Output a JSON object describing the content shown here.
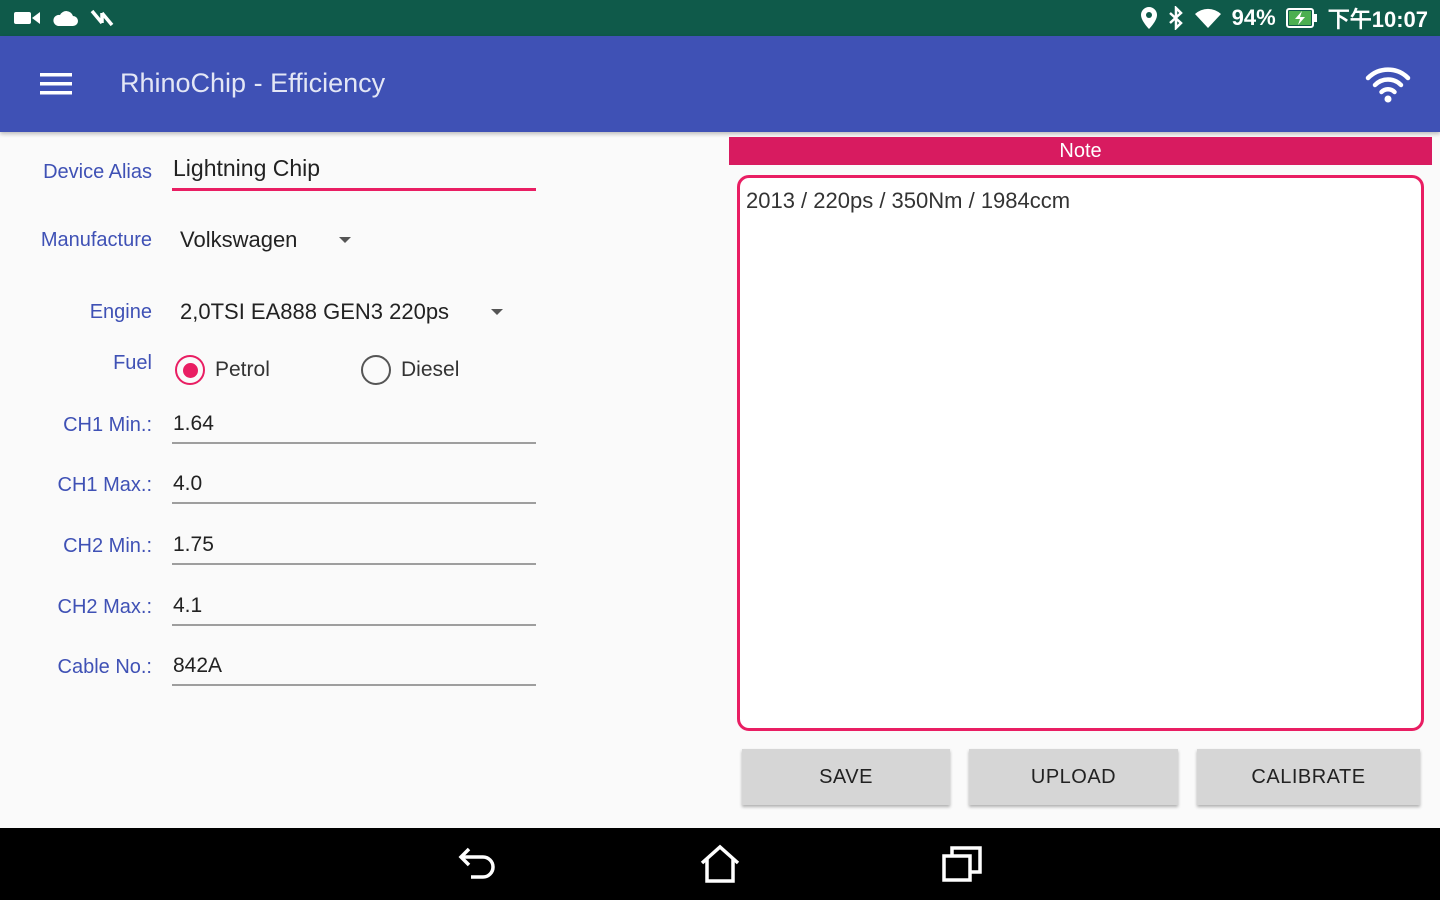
{
  "status_bar": {
    "battery": "94%",
    "time": "下午10:07"
  },
  "app_bar": {
    "title": "RhinoChip - Efficiency"
  },
  "form": {
    "device_alias_label": "Device Alias",
    "device_alias_value": "Lightning Chip",
    "manufacture_label": "Manufacture",
    "manufacture_value": "Volkswagen",
    "engine_label": "Engine",
    "engine_value": "2,0TSI EA888 GEN3 220ps",
    "fuel_label": "Fuel",
    "fuel_options": [
      "Petrol",
      "Diesel"
    ],
    "fuel_selected": "Petrol",
    "ch1_min_label": "CH1 Min.:",
    "ch1_min_value": "1.64",
    "ch1_max_label": "CH1 Max.:",
    "ch1_max_value": "4.0",
    "ch2_min_label": "CH2 Min.:",
    "ch2_min_value": "1.75",
    "ch2_max_label": "CH2 Max.:",
    "ch2_max_value": "4.1",
    "cable_no_label": "Cable No.:",
    "cable_no_value": "842A"
  },
  "note": {
    "header": "Note",
    "text": "2013 / 220ps / 350Nm / 1984ccm"
  },
  "buttons": {
    "save": "SAVE",
    "upload": "UPLOAD",
    "calibrate": "CALIBRATE"
  },
  "colors": {
    "status_bar": "#0f5a4a",
    "app_bar": "#3f51b5",
    "accent": "#e91e63",
    "note_header": "#d81b60"
  },
  "icons": {
    "status_left": [
      "video-camera-icon",
      "cloud-icon",
      "nfc-icon"
    ],
    "status_right": [
      "location-icon",
      "bluetooth-icon",
      "wifi-icon",
      "battery-charging-icon"
    ],
    "app_bar": [
      "menu-icon",
      "wifi-icon"
    ],
    "nav_bar": [
      "back-icon",
      "home-icon",
      "recents-icon"
    ]
  }
}
